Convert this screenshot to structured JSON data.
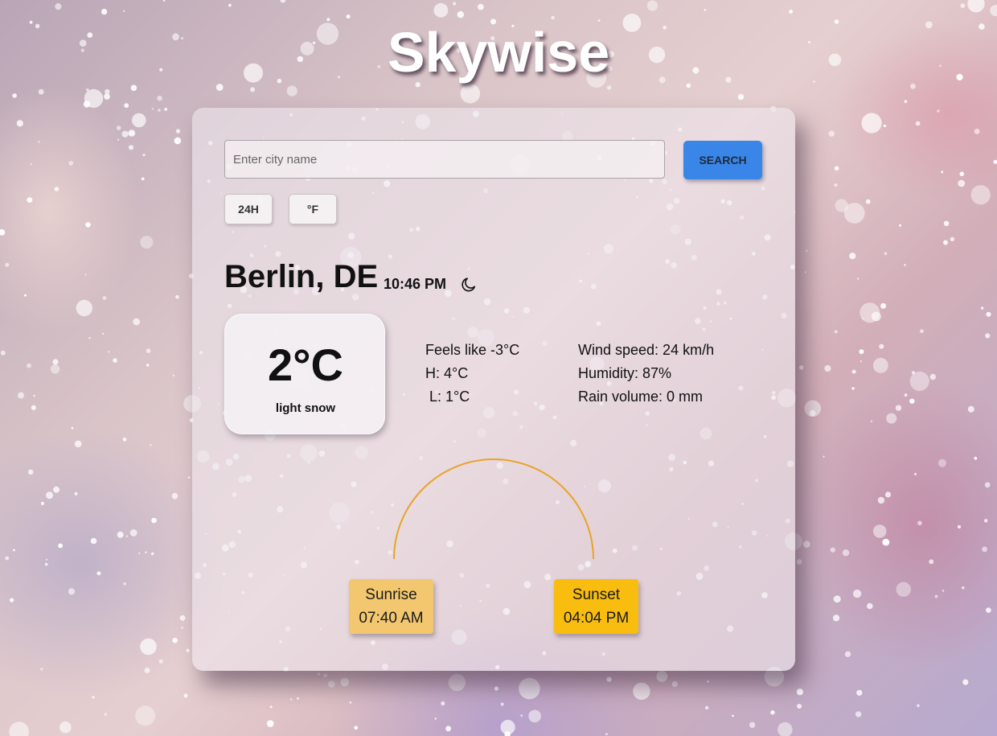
{
  "app": {
    "title": "Skywise"
  },
  "search": {
    "placeholder": "Enter city name",
    "value": "",
    "button_label": "SEARCH"
  },
  "toggles": {
    "time_format": "24H",
    "unit": "°F"
  },
  "location": {
    "city": "Berlin, DE",
    "local_time": "10:46 PM",
    "time_of_day_icon": "moon-icon"
  },
  "current": {
    "temperature": "2°C",
    "description": "light snow"
  },
  "details": {
    "feels_like": "Feels like -3°C",
    "high": "H: 4°C",
    "low": " L: 1°C",
    "wind_speed": "Wind speed: 24 km/h",
    "humidity": "Humidity: 87%",
    "rain_volume": "Rain volume: 0 mm"
  },
  "sun": {
    "sunrise_label": "Sunrise",
    "sunrise_time": "07:40 AM",
    "sunset_label": "Sunset",
    "sunset_time": "04:04 PM",
    "arc_color": "#e8a32a"
  },
  "colors": {
    "search_button": "#3a86e8",
    "sunrise_card": "#f3c76f",
    "sunset_card": "#f8bd0f"
  }
}
